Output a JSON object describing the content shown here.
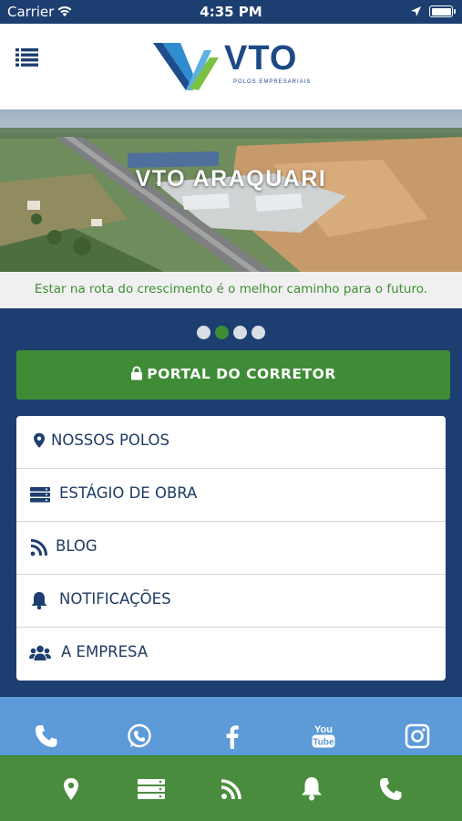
{
  "status_bar": {
    "carrier": "Carrier",
    "time": "4:35 PM"
  },
  "header": {
    "logo_text": "VTO",
    "logo_tagline": "POLOS EMPRESARIAIS",
    "menu_icon": "list-icon"
  },
  "hero": {
    "title": "VTO ARAQUARI",
    "slogan": "Estar na rota do crescimento é o melhor caminho para o futuro."
  },
  "carousel": {
    "page_count": 4,
    "active_index": 1
  },
  "portal_button": {
    "label": "PORTAL DO CORRETOR",
    "icon": "lock-icon"
  },
  "menu": {
    "items": [
      {
        "label": "NOSSOS POLOS",
        "icon": "map-marker-icon"
      },
      {
        "label": "ESTÁGIO DE OBRA",
        "icon": "server-icon"
      },
      {
        "label": "BLOG",
        "icon": "rss-icon"
      },
      {
        "label": "NOTIFICAÇÕES",
        "icon": "bell-icon"
      },
      {
        "label": "A EMPRESA",
        "icon": "users-icon"
      }
    ]
  },
  "social": {
    "items": [
      {
        "icon": "phone-icon"
      },
      {
        "icon": "whatsapp-icon"
      },
      {
        "icon": "facebook-icon"
      },
      {
        "icon": "youtube-icon",
        "text_top": "You",
        "text_bottom": "Tube"
      },
      {
        "icon": "instagram-icon"
      }
    ]
  },
  "tab_bar": {
    "items": [
      {
        "icon": "map-marker-icon"
      },
      {
        "icon": "server-icon"
      },
      {
        "icon": "rss-icon"
      },
      {
        "icon": "bell-icon"
      },
      {
        "icon": "phone-icon"
      }
    ]
  },
  "colors": {
    "navy": "#1d3e70",
    "green": "#3f8c36",
    "slogan_green": "#3e8d35",
    "social_blue": "#5c9ad8",
    "tab_green": "#4a8c3e"
  }
}
